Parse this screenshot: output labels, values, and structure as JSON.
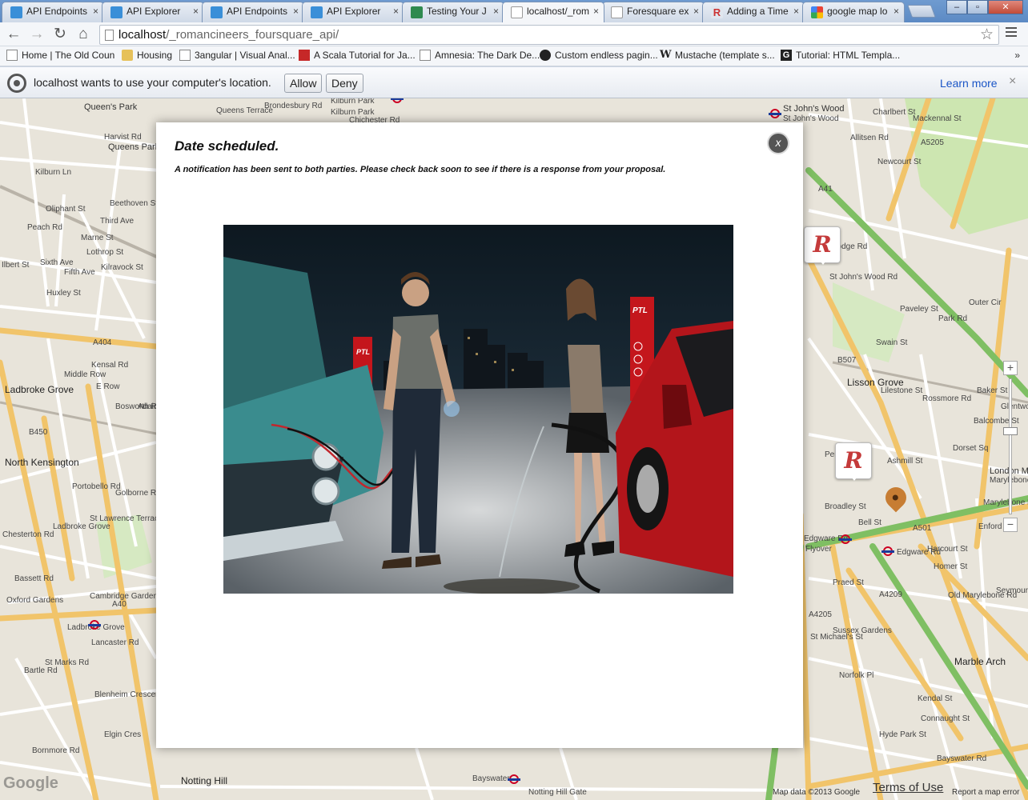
{
  "tabs": [
    {
      "label": "API Endpoints",
      "icon": "check-blue-icon",
      "active": false
    },
    {
      "label": "API Explorer",
      "icon": "check-blue-icon",
      "active": false
    },
    {
      "label": "API Endpoints",
      "icon": "check-blue-icon",
      "active": false
    },
    {
      "label": "API Explorer",
      "icon": "check-blue-icon",
      "active": false
    },
    {
      "label": "Testing Your J",
      "icon": "plus-green-icon",
      "active": false
    },
    {
      "label": "localhost/_rom",
      "icon": "page-icon",
      "active": true
    },
    {
      "label": "Foresquare ex",
      "icon": "page-icon",
      "active": false
    },
    {
      "label": "Adding a Time",
      "icon": "r-logo-icon",
      "active": false
    },
    {
      "label": "google map lo",
      "icon": "google-icon",
      "active": false
    }
  ],
  "tab_close_glyph": "×",
  "window_controls": {
    "minimize": "–",
    "maximize": "▫",
    "close": "✕"
  },
  "nav": {
    "back": "←",
    "forward": "→",
    "reload": "↻",
    "home": "⌂"
  },
  "address": {
    "host": "localhost",
    "path": "/_romancineers_foursquare_api/"
  },
  "bookmarks": [
    {
      "label": "Home | The Old Coun",
      "icon": "page-icon"
    },
    {
      "label": "Housing",
      "icon": "folder-icon"
    },
    {
      "label": "3angular | Visual Anal...",
      "icon": "page-icon"
    },
    {
      "label": "A Scala Tutorial for Ja...",
      "icon": "scala-icon"
    },
    {
      "label": "Amnesia: The Dark De...",
      "icon": "page-icon"
    },
    {
      "label": "Custom endless pagin...",
      "icon": "github-icon"
    },
    {
      "label": "Mustache (template s...",
      "icon": "wikipedia-icon"
    },
    {
      "label": "Tutorial: HTML Templa...",
      "icon": "g-icon"
    }
  ],
  "bookmarks_more": "»",
  "infobar": {
    "message": "localhost wants to use your computer's location.",
    "allow": "Allow",
    "deny": "Deny",
    "learn_more": "Learn more",
    "close": "×"
  },
  "modal": {
    "title": "Date scheduled.",
    "text": "A notification has been sent to both parties. Please check back soon to see if there is a response from your proposal.",
    "close": "x",
    "photo_signs": [
      "PTL",
      "PTL"
    ]
  },
  "map": {
    "areas": [
      "Queen's Park",
      "Queens Park",
      "Ladbroke Grove",
      "North Kensington",
      "Lisson Grove",
      "Marble Arch",
      "Notting Hill",
      "St John's Wood",
      "London Marylebone"
    ],
    "streets": [
      "Kilburn Ln",
      "Harvist Rd",
      "Oliphant St",
      "Beethoven St",
      "Third Ave",
      "Fifth Ave",
      "Marne St",
      "Lothrop St",
      "Kilravock St",
      "Huxley St",
      "Ilbert St",
      "Sixth Ave",
      "Peach Rd",
      "A404",
      "Kensal Rd",
      "Middle Row",
      "E Row",
      "Bosworth Rd",
      "Adair Rd",
      "B450",
      "Portobello Rd",
      "Golborne Rd",
      "Ladbroke Grove",
      "Oxford Gardens",
      "Bassett Rd",
      "St Lawrence Terrace",
      "Cambridge Gardens",
      "A40",
      "Lancaster Rd",
      "St Marks Rd",
      "Bartle Rd",
      "Blenheim Crescent",
      "Elgin Cres",
      "Chesterton Rd",
      "Bornmore Rd",
      "Kilburn Park",
      "Brondesbury Rd",
      "Chichester Rd",
      "Queens Terrace",
      "A41",
      "Park Rd",
      "Outer Cir",
      "A5205",
      "Charlbert St",
      "Allitsen Rd",
      "Newcourt St",
      "Mackennal St",
      "St John's Wood Rd",
      "Lodge Rd",
      "Paveley St",
      "Swain St",
      "Rossmore Rd",
      "B507",
      "Lilestone St",
      "Broadley St",
      "Penfold St",
      "Bell St",
      "Edgware Rd",
      "A501",
      "Marylebone Rd",
      "Enford St",
      "Harcourt St",
      "Homer St",
      "Old Marylebone Rd",
      "Praed St",
      "Sussex Gardens",
      "A4209",
      "A4205",
      "St Michael's St",
      "Norfolk Pl",
      "Kendal St",
      "Bayswater Rd",
      "Hyde Park St",
      "Connaught St",
      "Seymour Pl",
      "Glentworth St",
      "Baker St",
      "Flyover",
      "Ashmill St",
      "Dorset Sq",
      "Balcombe St"
    ],
    "stations": [
      "Kilburn Park",
      "St John's Wood",
      "Edgware Rd",
      "Marylebone",
      "Ladbroke Grove",
      "Bayswater",
      "Notting Hill Gate"
    ],
    "markers": [
      "R",
      "R"
    ],
    "zoom_in": "+",
    "zoom_out": "−",
    "attribution": "Map data ©2013 Google",
    "terms": "Terms of Use",
    "report": "Report a map error",
    "logo": "Google"
  },
  "colors": {
    "major_road": "#f1c46a",
    "road": "#ffffff",
    "park": "#cde6b1",
    "water": "#a6c6e6",
    "green_road": "#7fbf63"
  }
}
